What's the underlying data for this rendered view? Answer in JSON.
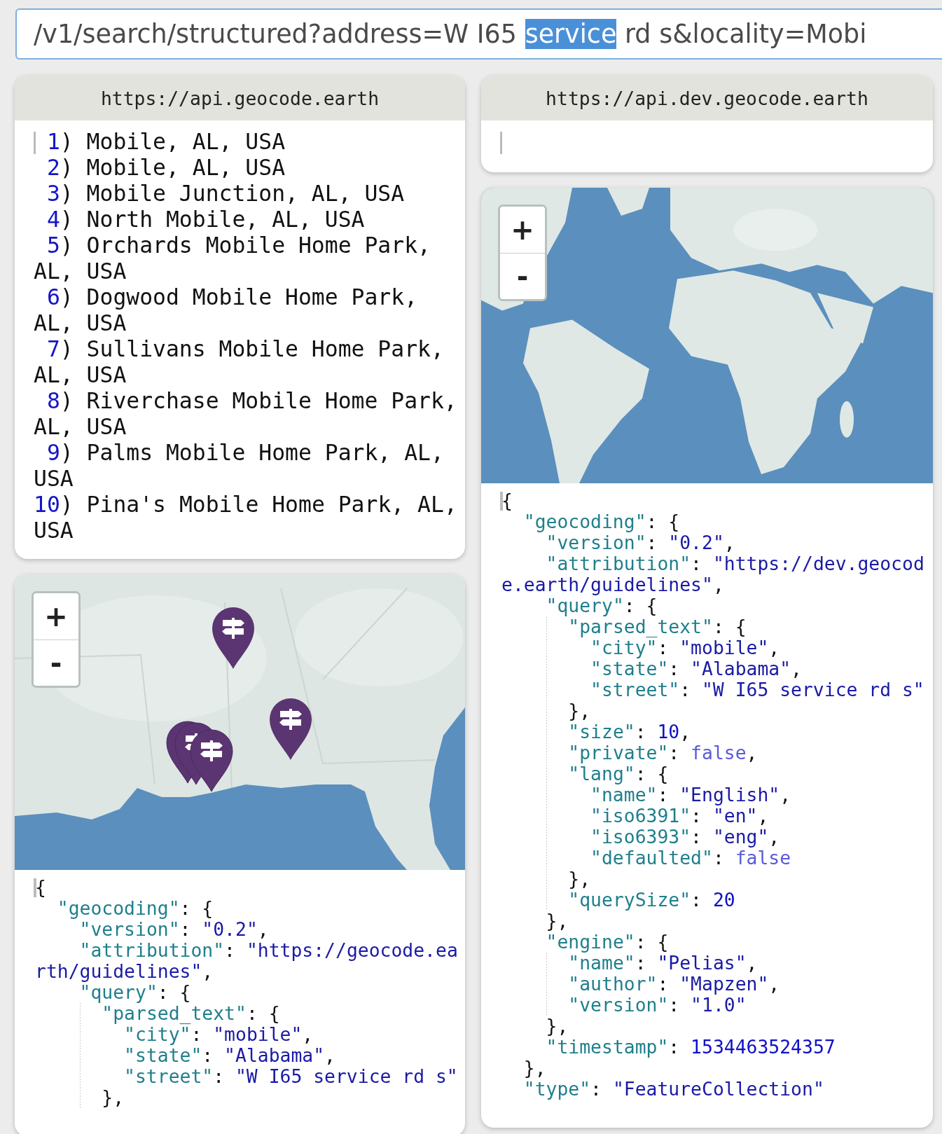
{
  "query_field": {
    "parts": [
      {
        "text": "/v1/search/structured?address=W I65 ",
        "selected": false
      },
      {
        "text": "service",
        "selected": true
      },
      {
        "text": " rd s&locality=Mobi",
        "selected": false
      }
    ]
  },
  "panes": [
    {
      "url": "https://api.geocode.earth",
      "results": [
        {
          "number": "1",
          "delimiter": ")",
          "text": "Mobile, AL, USA"
        },
        {
          "number": "2",
          "delimiter": ")",
          "text": "Mobile, AL, USA"
        },
        {
          "number": "3",
          "delimiter": ")",
          "text": "Mobile Junction, AL, USA"
        },
        {
          "number": "4",
          "delimiter": ")",
          "text": "North Mobile, AL, USA"
        },
        {
          "number": "5",
          "delimiter": ")",
          "text": "Orchards Mobile Home Park, AL, USA"
        },
        {
          "number": "6",
          "delimiter": ")",
          "text": "Dogwood Mobile Home Park, AL, USA"
        },
        {
          "number": "7",
          "delimiter": ")",
          "text": "Sullivans Mobile Home Park, AL, USA"
        },
        {
          "number": "8",
          "delimiter": ")",
          "text": "Riverchase Mobile Home Park, AL, USA"
        },
        {
          "number": "9",
          "delimiter": ")",
          "text": "Palms Mobile Home Park, AL, USA"
        },
        {
          "number": "10",
          "delimiter": ")",
          "text": "Pina's Mobile Home Park, AL, USA"
        }
      ],
      "map": {
        "kind": "picture",
        "zoom_in": "+",
        "zoom_out": "-"
      },
      "code": [
        {
          "value": "{",
          "kind": "punct",
          "children": [
            {
              "key": "\"geocoding\"",
              "sep": ": ",
              "value": "{",
              "kind": "punct",
              "children": [
                {
                  "key": "\"version\"",
                  "sep": ": ",
                  "value": "\"0.2\"",
                  "kind": "string",
                  "tail": ","
                },
                {
                  "key": "\"attribution\"",
                  "sep": ": ",
                  "value": "\"https://geocode.earth/guidelines\"",
                  "kind": "string",
                  "tail": ","
                },
                {
                  "key": "\"query\"",
                  "sep": ": ",
                  "value": "{",
                  "kind": "punct",
                  "children": [
                    {
                      "key": "\"parsed_text\"",
                      "sep": ": ",
                      "value": "{",
                      "kind": "punct",
                      "children": [
                        {
                          "key": "\"city\"",
                          "sep": ": ",
                          "value": "\"mobile\"",
                          "kind": "string",
                          "tail": ","
                        },
                        {
                          "key": "\"state\"",
                          "sep": ": ",
                          "value": "\"Alabama\"",
                          "kind": "string",
                          "tail": ","
                        },
                        {
                          "key": "\"street\"",
                          "sep": ": ",
                          "value": "\"W I65 service rd s\"",
                          "kind": "string"
                        }
                      ]
                    },
                    {
                      "value": "},",
                      "kind": "punct"
                    }
                  ]
                }
              ]
            }
          ]
        }
      ]
    },
    {
      "url": "https://api.dev.geocode.earth",
      "map": {
        "kind": "picture",
        "zoom_in": "+",
        "zoom_out": "-"
      },
      "code": [
        {
          "value": "{",
          "kind": "punct",
          "children": [
            {
              "key": "\"geocoding\"",
              "sep": ": ",
              "value": "{",
              "kind": "punct",
              "children": [
                {
                  "key": "\"version\"",
                  "sep": ": ",
                  "value": "\"0.2\"",
                  "kind": "string",
                  "tail": ","
                },
                {
                  "key": "\"attribution\"",
                  "sep": ": ",
                  "value": "\"https://dev.geocode.earth/guidelines\"",
                  "kind": "string",
                  "tail": ","
                },
                {
                  "key": "\"query\"",
                  "sep": ": ",
                  "value": "{",
                  "kind": "punct",
                  "children": [
                    {
                      "key": "\"parsed_text\"",
                      "sep": ": ",
                      "value": "{",
                      "kind": "punct",
                      "children": [
                        {
                          "key": "\"city\"",
                          "sep": ": ",
                          "value": "\"mobile\"",
                          "kind": "string",
                          "tail": ","
                        },
                        {
                          "key": "\"state\"",
                          "sep": ": ",
                          "value": "\"Alabama\"",
                          "kind": "string",
                          "tail": ","
                        },
                        {
                          "key": "\"street\"",
                          "sep": ": ",
                          "value": "\"W I65 service rd s\"",
                          "kind": "string"
                        }
                      ]
                    },
                    {
                      "value": "},",
                      "kind": "punct"
                    },
                    {
                      "key": "\"size\"",
                      "sep": ": ",
                      "value": "10",
                      "kind": "number",
                      "tail": ","
                    },
                    {
                      "key": "\"private\"",
                      "sep": ": ",
                      "value": "false",
                      "kind": "boolean",
                      "tail": ","
                    },
                    {
                      "key": "\"lang\"",
                      "sep": ": ",
                      "value": "{",
                      "kind": "punct",
                      "children": [
                        {
                          "key": "\"name\"",
                          "sep": ": ",
                          "value": "\"English\"",
                          "kind": "string",
                          "tail": ","
                        },
                        {
                          "key": "\"iso6391\"",
                          "sep": ": ",
                          "value": "\"en\"",
                          "kind": "string",
                          "tail": ","
                        },
                        {
                          "key": "\"iso6393\"",
                          "sep": ": ",
                          "value": "\"eng\"",
                          "kind": "string",
                          "tail": ","
                        },
                        {
                          "key": "\"defaulted\"",
                          "sep": ": ",
                          "value": "false",
                          "kind": "boolean"
                        }
                      ]
                    },
                    {
                      "value": "},",
                      "kind": "punct"
                    },
                    {
                      "key": "\"querySize\"",
                      "sep": ": ",
                      "value": "20",
                      "kind": "number"
                    }
                  ]
                },
                {
                  "value": "},",
                  "kind": "punct"
                },
                {
                  "key": "\"engine\"",
                  "sep": ": ",
                  "value": "{",
                  "kind": "punct",
                  "children": [
                    {
                      "key": "\"name\"",
                      "sep": ": ",
                      "value": "\"Pelias\"",
                      "kind": "string",
                      "tail": ","
                    },
                    {
                      "key": "\"author\"",
                      "sep": ": ",
                      "value": "\"Mapzen\"",
                      "kind": "string",
                      "tail": ","
                    },
                    {
                      "key": "\"version\"",
                      "sep": ": ",
                      "value": "\"1.0\"",
                      "kind": "string"
                    }
                  ]
                },
                {
                  "value": "},",
                  "kind": "punct"
                },
                {
                  "key": "\"timestamp\"",
                  "sep": ": ",
                  "value": "1534463524357",
                  "kind": "number"
                }
              ]
            },
            {
              "value": "},",
              "kind": "punct"
            },
            {
              "key": "\"type\"",
              "sep": ": ",
              "value": "\"FeatureCollection\"",
              "kind": "string"
            }
          ]
        }
      ]
    }
  ]
}
